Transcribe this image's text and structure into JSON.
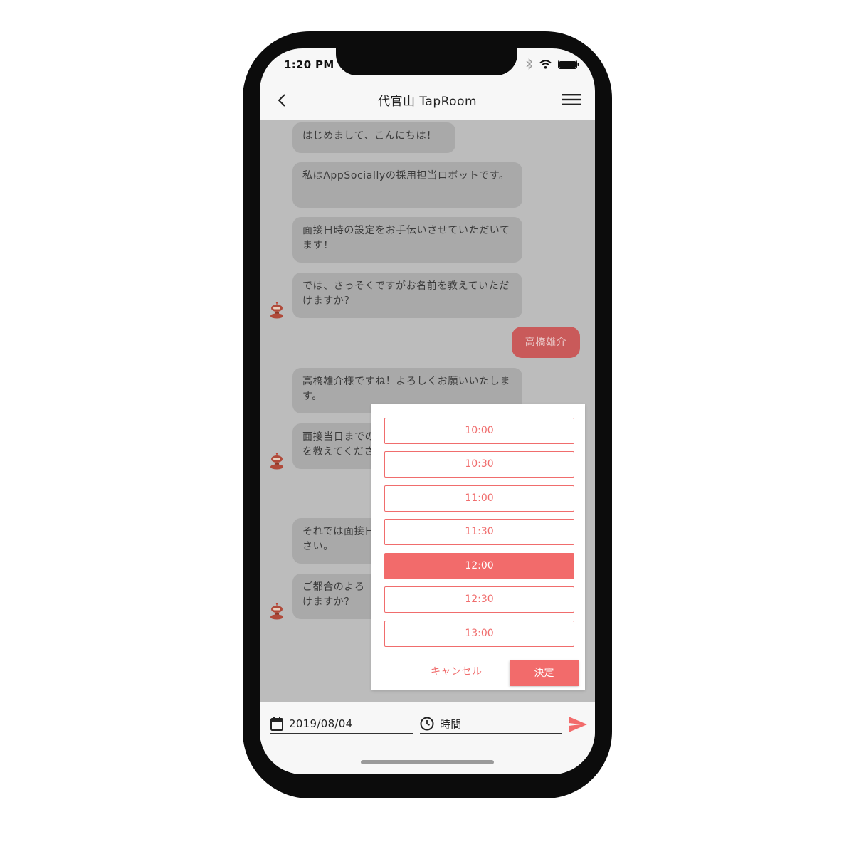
{
  "status_bar": {
    "time": "1:20 PM"
  },
  "header": {
    "title": "代官山 TapRoom"
  },
  "messages": [
    {
      "text": "はじめまして、こんにちは！"
    },
    {
      "text": "私はAppSociallyの採用担当ロボットです。"
    },
    {
      "text": "面接日時の設定をお手伝いさせていただいてます！"
    },
    {
      "text": "では、さっそくですがお名前を教えていただけますか？"
    },
    {
      "text": "高橋雄介"
    },
    {
      "text": "高橋雄介様ですね！よろしくお願いいたします。"
    },
    {
      "text": "面接当日までの"
    },
    {
      "text": "を教えてくださ"
    },
    {
      "text": "それでは面接日"
    },
    {
      "text": "さい。"
    },
    {
      "text": "ご都合のよろ"
    },
    {
      "text": "けますか？"
    }
  ],
  "time_picker": {
    "slots": [
      "10:00",
      "10:30",
      "11:00",
      "11:30",
      "12:00",
      "12:30",
      "13:00"
    ],
    "selected": "12:00",
    "cancel_label": "キャンセル",
    "confirm_label": "決定"
  },
  "input_bar": {
    "date_value": "2019/08/04",
    "time_placeholder": "時間"
  },
  "colors": {
    "accent": "#f26b6b",
    "user_bubble": "#c95a5a",
    "bot_bubble": "#a9a9a9",
    "overlay": "#bcbcbc"
  }
}
